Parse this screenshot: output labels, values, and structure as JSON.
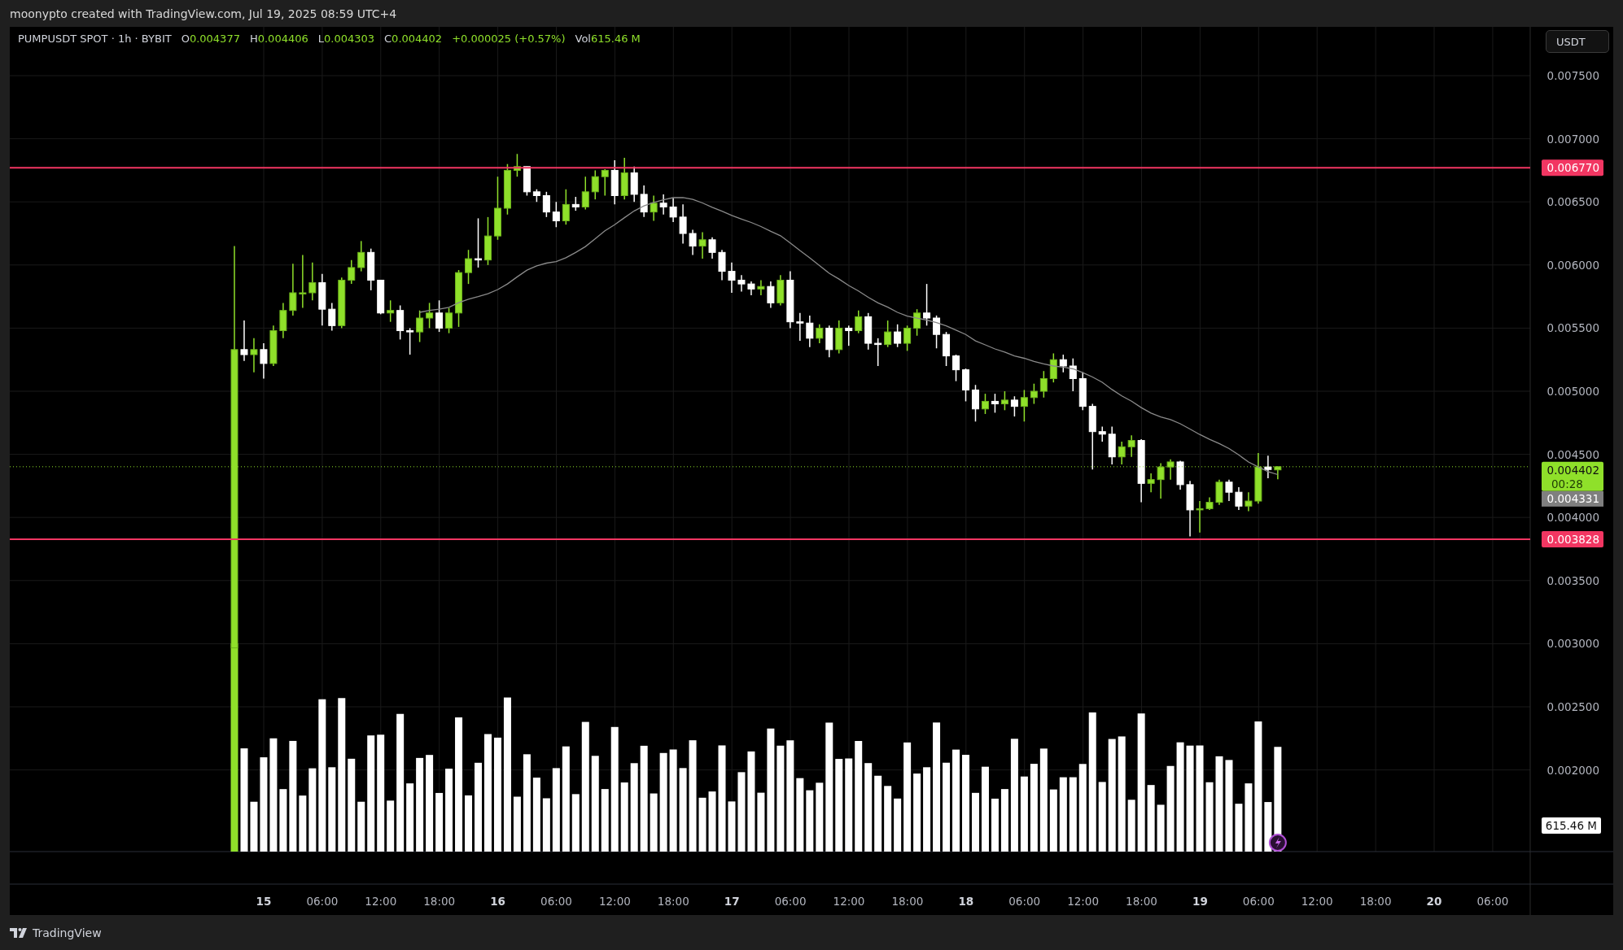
{
  "header": {
    "title": "moonypto created with TradingView.com, Jul 19, 2025 08:59 UTC+4"
  },
  "legend": {
    "symbol": "PUMPUSDT SPOT · 1h · BYBIT",
    "fields": [
      {
        "label": "O",
        "value": "0.004377"
      },
      {
        "label": "H",
        "value": "0.004406"
      },
      {
        "label": "L",
        "value": "0.004303"
      },
      {
        "label": "C",
        "value": "0.004402"
      }
    ],
    "change": "+0.000025 (+0.57%)",
    "volume": {
      "label": "Vol",
      "value": "615.46 M"
    }
  },
  "currency_button": "USDT",
  "price_axis": {
    "labels": [
      "0.007500",
      "0.007000",
      "0.006500",
      "0.006000",
      "0.005500",
      "0.005000",
      "0.004500",
      "0.004000",
      "0.003500",
      "0.003000",
      "0.002500",
      "0.002000"
    ]
  },
  "time_axis": {
    "labels": [
      {
        "label": "15",
        "kind": "day"
      },
      {
        "label": "06:00",
        "kind": "time"
      },
      {
        "label": "12:00",
        "kind": "time"
      },
      {
        "label": "18:00",
        "kind": "time"
      },
      {
        "label": "16",
        "kind": "day"
      },
      {
        "label": "06:00",
        "kind": "time"
      },
      {
        "label": "12:00",
        "kind": "time"
      },
      {
        "label": "18:00",
        "kind": "time"
      },
      {
        "label": "17",
        "kind": "day"
      },
      {
        "label": "06:00",
        "kind": "time"
      },
      {
        "label": "12:00",
        "kind": "time"
      },
      {
        "label": "18:00",
        "kind": "time"
      },
      {
        "label": "18",
        "kind": "day"
      },
      {
        "label": "06:00",
        "kind": "time"
      },
      {
        "label": "12:00",
        "kind": "time"
      },
      {
        "label": "18:00",
        "kind": "time"
      },
      {
        "label": "19",
        "kind": "day"
      },
      {
        "label": "06:00",
        "kind": "time"
      },
      {
        "label": "12:00",
        "kind": "time"
      },
      {
        "label": "18:00",
        "kind": "time"
      },
      {
        "label": "20",
        "kind": "day"
      },
      {
        "label": "06:00",
        "kind": "time"
      }
    ]
  },
  "price_tags": [
    {
      "kind": "level",
      "label": "0.006770"
    },
    {
      "kind": "last_price",
      "label": "0.004402",
      "countdown": "00:28"
    },
    {
      "kind": "moving_average",
      "label": "0.004331"
    },
    {
      "kind": "level",
      "label": "0.003828"
    },
    {
      "kind": "volume",
      "label": "615.46 M"
    }
  ],
  "footer": {
    "brand": "TradingView"
  }
}
